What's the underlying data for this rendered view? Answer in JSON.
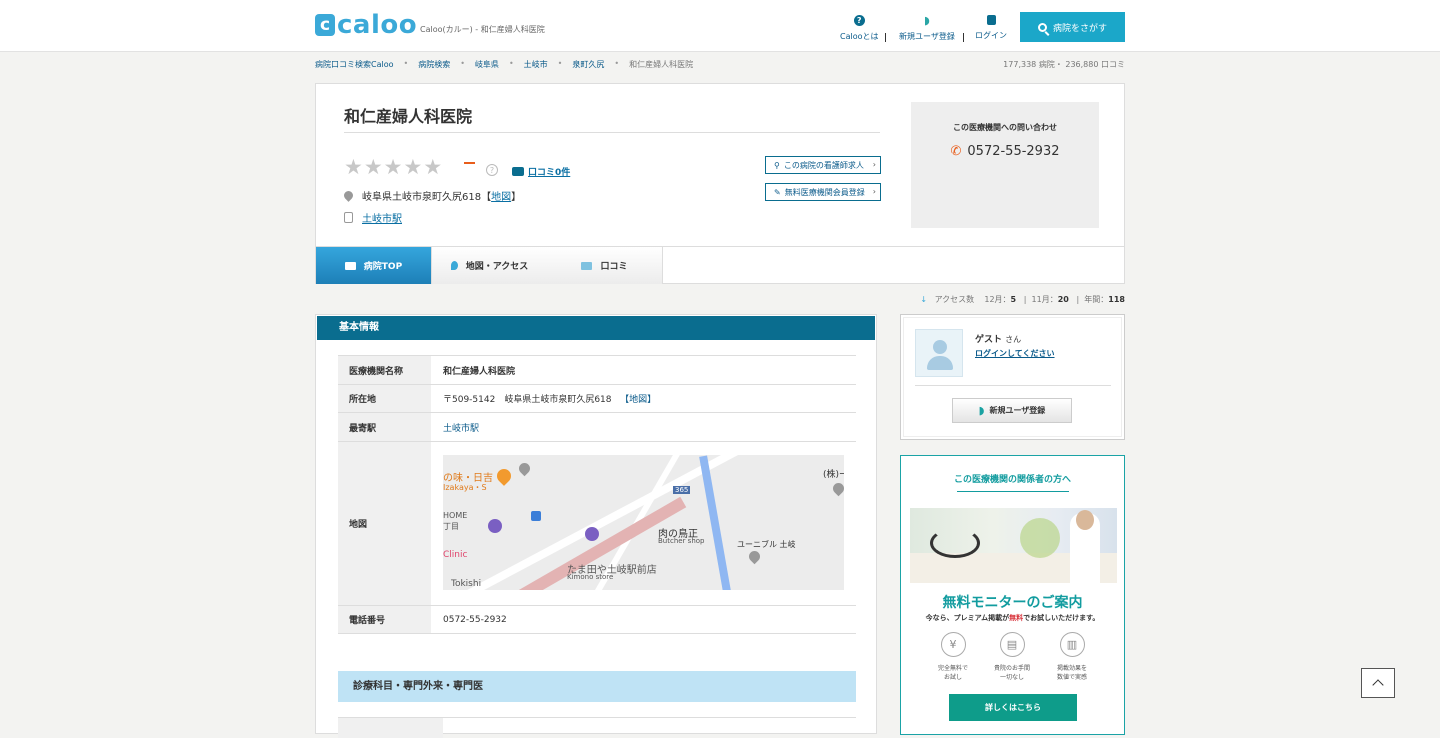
{
  "header": {
    "logo_mark": "c",
    "logo_text": "caloo",
    "tagline": "Caloo(カルー) - 和仁産婦人科医院",
    "nav": [
      {
        "label": "Calooとは",
        "icon": "question-icon"
      },
      {
        "label": "新規ユーザ登録",
        "icon": "beginner-leaf-icon"
      },
      {
        "label": "ログイン",
        "icon": "lock-icon"
      }
    ],
    "search_button": "病院をさがす"
  },
  "breadcrumb": [
    "病院口コミ検索Caloo",
    "病院検索",
    "岐阜県",
    "土岐市",
    "泉町久尻",
    "和仁産婦人科医院"
  ],
  "counts": {
    "hospitals": "177,338",
    "hospitals_unit": "病院",
    "reviews": "236,880",
    "reviews_unit": "口コミ"
  },
  "hospital": {
    "name": "和仁産婦人科医院",
    "rating_dash": "ー",
    "help": "?",
    "review_link": "口コミ0件",
    "address": "岐阜県土岐市泉町久尻618",
    "map_link": "地図",
    "station": "土岐市駅",
    "btn_nurse": "この病院の看護師求人",
    "btn_member": "無料医療機関会員登録"
  },
  "contact": {
    "title": "この医療機関への問い合わせ",
    "tel": "0572-55-2932"
  },
  "tabs": [
    {
      "label": "病院TOP",
      "active": true
    },
    {
      "label": "地図・アクセス",
      "active": false
    },
    {
      "label": "口コミ",
      "active": false
    }
  ],
  "access": {
    "label": "アクセス数",
    "m12_label": "12月：",
    "m12": "5",
    "m11_label": "11月：",
    "m11": "20",
    "year_label": "年間：",
    "year": "118"
  },
  "basic_info": {
    "heading": "基本情報",
    "rows": {
      "name_label": "医療機関名称",
      "name_value": "和仁産婦人科医院",
      "addr_label": "所在地",
      "addr_value": "〒509-5142　岐阜県土岐市泉町久尻618",
      "addr_map": "【地図】",
      "station_label": "最寄駅",
      "station_value": "土岐市駅",
      "map_label": "地図",
      "tel_label": "電話番号",
      "tel_value": "0572-55-2932"
    },
    "map_labels": {
      "izakaya": "の味・日吉",
      "izakaya_en": "Izakaya・S",
      "home": "HOME",
      "home2": "丁目",
      "clinic": "Clinic",
      "butcher": "肉の鳥正",
      "butcher_en": "Butcher shop",
      "kimono": "たま田や土岐駅前店",
      "kimono_en": "Kimono store",
      "tokishi": "Tokishi",
      "unible": "ユーニブル 土岐",
      "kabu": "(株)ー",
      "route": "365"
    },
    "sub_heading": "診療科目・専門外来・専門医"
  },
  "guest": {
    "name": "ゲスト",
    "honorific": "さん",
    "login": "ログインしてください",
    "register": "新規ユーザ登録"
  },
  "promo": {
    "title": "この医療機関の関係者の方へ",
    "headline": "無料モニターのご案内",
    "sub_pre": "今なら、プレミアム掲載が",
    "sub_red": "無料",
    "sub_post": "でお試しいただけます。",
    "features": [
      {
        "icon": "yen-icon",
        "glyph": "¥",
        "line1": "完全無料で",
        "line2": "お試し"
      },
      {
        "icon": "document-icon",
        "glyph": "▤",
        "line1": "貴院のお手間",
        "line2": "一切なし"
      },
      {
        "icon": "chart-icon",
        "glyph": "▥",
        "line1": "掲載効果を",
        "line2": "数値で実感"
      }
    ],
    "button": "詳しくはこちら"
  },
  "colors": {
    "accent": "#0a6d8f",
    "brand": "#3ba9d8",
    "teal": "#129c9f",
    "orange": "#e85d1b"
  }
}
